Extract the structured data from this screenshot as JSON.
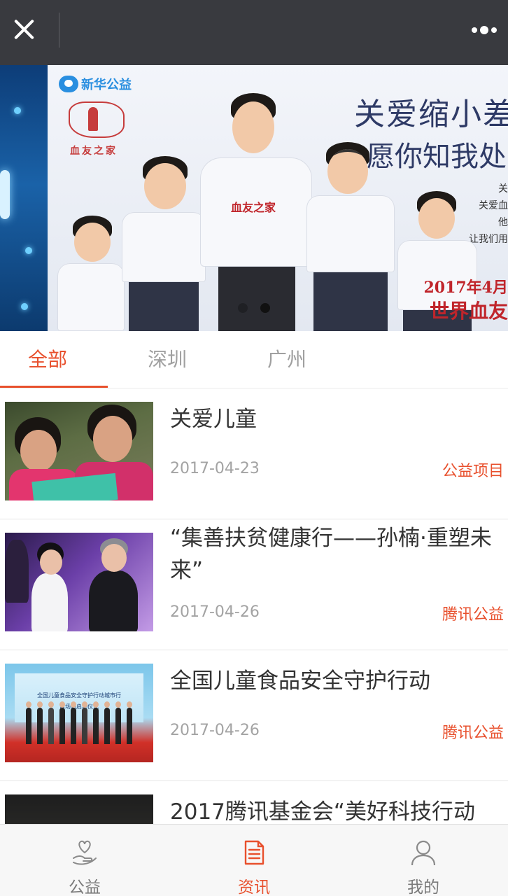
{
  "topbar": {
    "close_icon": "close-icon",
    "more_icon": "more-icon"
  },
  "banner": {
    "logo_text": "新华公益",
    "home_text": "血友之家",
    "headline_1": "关爱缩小差",
    "headline_2": "愿你知我处",
    "side_lines": [
      "关",
      "关爱血",
      "他",
      "让我们用"
    ],
    "shirt_text": "血友之家",
    "date_text": "2017年4月",
    "event_text": "世界血友",
    "active_slide": 2,
    "slide_count": 2
  },
  "tabs": [
    {
      "label": "全部",
      "active": true
    },
    {
      "label": "深圳",
      "active": false
    },
    {
      "label": "广州",
      "active": false
    }
  ],
  "news": [
    {
      "title": "关爱儿童",
      "date": "2017-04-23",
      "source": "公益项目"
    },
    {
      "title": "“集善扶贫健康行——孙楠·重塑未来”",
      "date": "2017-04-26",
      "source": "腾讯公益"
    },
    {
      "title": "全国儿童食品安全守护行动",
      "date": "2017-04-26",
      "source": "腾讯公益"
    },
    {
      "title": "2017腾讯基金会“美好科技行动",
      "date": "",
      "source": ""
    }
  ],
  "thumb3": {
    "board_line1": "全国儿童食品安全守护行动城市行",
    "board_line2": "首场站启动仪式"
  },
  "bottom_nav": [
    {
      "label": "公益",
      "icon": "heart-hand-icon",
      "active": false
    },
    {
      "label": "资讯",
      "icon": "document-icon",
      "active": true
    },
    {
      "label": "我的",
      "icon": "user-icon",
      "active": false
    }
  ],
  "colors": {
    "accent": "#e8502d",
    "topbar": "#393a3f",
    "muted_text": "#a3a3a3"
  }
}
